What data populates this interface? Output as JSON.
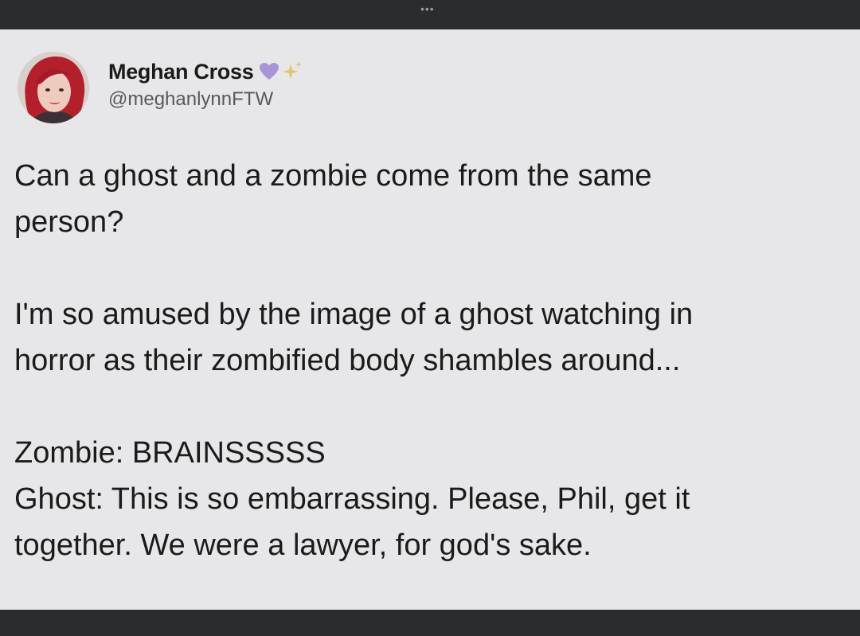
{
  "tweet": {
    "author": {
      "display_name": "Meghan Cross",
      "handle": "@meghanlynnFTW",
      "badges": [
        "purple-heart-icon",
        "sparkle-icon"
      ]
    },
    "paragraphs": [
      [
        "Can a ghost and a zombie come from the same",
        "person?"
      ],
      [
        "I'm so amused by the image of a ghost watching in",
        "horror as their zombified body shambles around..."
      ],
      [
        "Zombie: BRAINSSSSS",
        "Ghost: This is so embarrassing. Please, Phil, get it",
        "together. We were a lawyer, for god's sake."
      ]
    ]
  },
  "colors": {
    "card_background": "#e7e7e9",
    "frame_background": "#2b2c2e",
    "heart": "#a894d6",
    "sparkle": "#e2c46a"
  }
}
